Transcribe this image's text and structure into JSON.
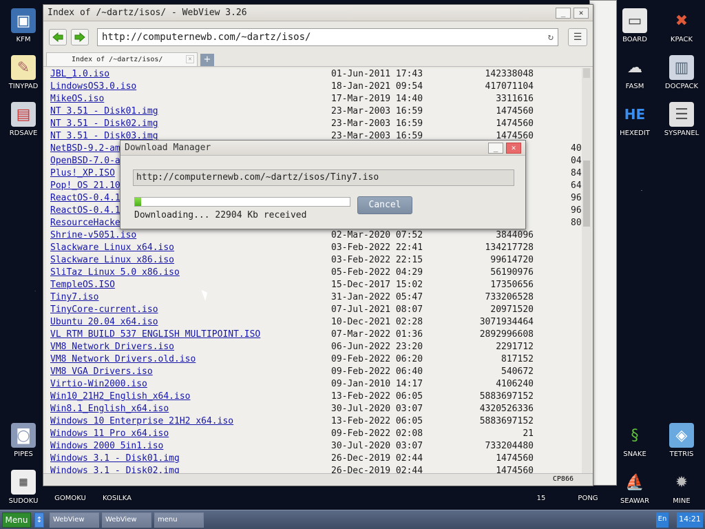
{
  "desktop": {
    "icons_left": [
      {
        "label": "KFM"
      },
      {
        "label": "TINYPAD"
      },
      {
        "label": "RDSAVE"
      },
      {
        "label": "PIPES"
      },
      {
        "label": "SUDOKU"
      },
      {
        "label": "GOMOKU"
      },
      {
        "label": "KOSILKA"
      }
    ],
    "icons_right": [
      {
        "label": "BOARD"
      },
      {
        "label": "KPACK"
      },
      {
        "label": "FASM"
      },
      {
        "label": "DOCPACK"
      },
      {
        "label": "HEXEDIT"
      },
      {
        "label": "SYSPANEL"
      },
      {
        "label": "SNAKE"
      },
      {
        "label": "TETRIS"
      },
      {
        "label": "15"
      },
      {
        "label": "PONG"
      },
      {
        "label": "SEAWAR"
      },
      {
        "label": "MINE"
      }
    ],
    "hexedit_glyph": "HE"
  },
  "browser": {
    "title": "Index of /~dartz/isos/ - WebView 3.26",
    "url": "http://computernewb.com/~dartz/isos/",
    "tab_label": "Index of /~dartz/isos/",
    "tab_add": "+",
    "status_encoding": "CP866",
    "listing": [
      {
        "name": "JBL_1.0.iso",
        "date": "01-Jun-2011 17:43",
        "size": "142338048"
      },
      {
        "name": "LindowsOS3.0.iso",
        "date": "18-Jan-2021 09:54",
        "size": "417071104"
      },
      {
        "name": "MikeOS.iso",
        "date": "17-Mar-2019 14:40",
        "size": "3311616"
      },
      {
        "name": "NT 3.51 - Disk01.img",
        "date": "23-Mar-2003 16:59",
        "size": "1474560"
      },
      {
        "name": "NT 3.51 - Disk02.img",
        "date": "23-Mar-2003 16:59",
        "size": "1474560"
      },
      {
        "name": "NT 3.51 - Disk03.img",
        "date": "23-Mar-2003 16:59",
        "size": "1474560"
      },
      {
        "name": "NetBSD-9.2-am",
        "date": "",
        "size": ""
      },
      {
        "name": "OpenBSD-7.0-a",
        "date": "",
        "size": ""
      },
      {
        "name": "Plus!_XP.ISO",
        "date": "",
        "size": ""
      },
      {
        "name": "Pop!_OS 21.10",
        "date": "",
        "size": ""
      },
      {
        "name": "ReactOS-0.4.1",
        "date": "",
        "size": ""
      },
      {
        "name": "ReactOS-0.4.1",
        "date": "",
        "size": ""
      },
      {
        "name": "ResourceHacke",
        "date": "",
        "size": ""
      },
      {
        "name": "Shrine-v5051.iso",
        "date": "02-Mar-2020 07:52",
        "size": "3844096"
      },
      {
        "name": "Slackware Linux x64.iso",
        "date": "03-Feb-2022 22:41",
        "size": "134217728"
      },
      {
        "name": "Slackware Linux x86.iso",
        "date": "03-Feb-2022 22:15",
        "size": "99614720"
      },
      {
        "name": "SliTaz Linux 5.0 x86.iso",
        "date": "05-Feb-2022 04:29",
        "size": "56190976"
      },
      {
        "name": "TempleOS.ISO",
        "date": "15-Dec-2017 15:02",
        "size": "17350656"
      },
      {
        "name": "Tiny7.iso",
        "date": "31-Jan-2022 05:47",
        "size": "733206528"
      },
      {
        "name": "TinyCore-current.iso",
        "date": "07-Jul-2021 08:07",
        "size": "20971520"
      },
      {
        "name": "Ubuntu 20.04 x64.iso",
        "date": "10-Dec-2021 02:28",
        "size": "3071934464"
      },
      {
        "name": "VL RTM BUILD 537 ENGLISH MULTIPOINT.ISO",
        "date": "07-Mar-2022 01:36",
        "size": "2892996608"
      },
      {
        "name": "VM8 Network Drivers.iso",
        "date": "06-Jun-2022 23:20",
        "size": "2291712"
      },
      {
        "name": "VM8 Network Drivers.old.iso",
        "date": "09-Feb-2022 06:20",
        "size": "817152"
      },
      {
        "name": "VM8 VGA Drivers.iso",
        "date": "09-Feb-2022 06:40",
        "size": "540672"
      },
      {
        "name": "Virtio-Win2000.iso",
        "date": "09-Jan-2010 14:17",
        "size": "4106240"
      },
      {
        "name": "Win10_21H2_English_x64.iso",
        "date": "13-Feb-2022 06:05",
        "size": "5883697152"
      },
      {
        "name": "Win8.1_English_x64.iso",
        "date": "30-Jul-2020 03:07",
        "size": "4320526336"
      },
      {
        "name": "Windows 10 Enterprise 21H2 x64.iso",
        "date": "13-Feb-2022 06:05",
        "size": "5883697152"
      },
      {
        "name": "Windows 11 Pro x64.iso",
        "date": "09-Feb-2022 02:08",
        "size": "21"
      },
      {
        "name": "Windows 2000 5in1.iso",
        "date": "30-Jul-2020 03:07",
        "size": "733204480"
      },
      {
        "name": "Windows 3.1 - Disk01.img",
        "date": "26-Dec-2019 02:44",
        "size": "1474560"
      },
      {
        "name": "Windows 3.1 - Disk02.img",
        "date": "26-Dec-2019 02:44",
        "size": "1474560"
      }
    ],
    "hidden_sizes": [
      "40",
      "04",
      "84",
      "64",
      "96",
      "96",
      "80"
    ]
  },
  "download": {
    "title": "Download Manager",
    "url": "http://computernewb.com/~dartz/isos/Tiny7.iso",
    "progress": 0.03,
    "cancel_label": "Cancel",
    "status": "Downloading... 22904 Kb received"
  },
  "taskbar": {
    "menu_label": "Menu",
    "tasks": [
      "WebView",
      "WebView",
      "menu"
    ],
    "lang": "En",
    "clock": "14:21"
  }
}
